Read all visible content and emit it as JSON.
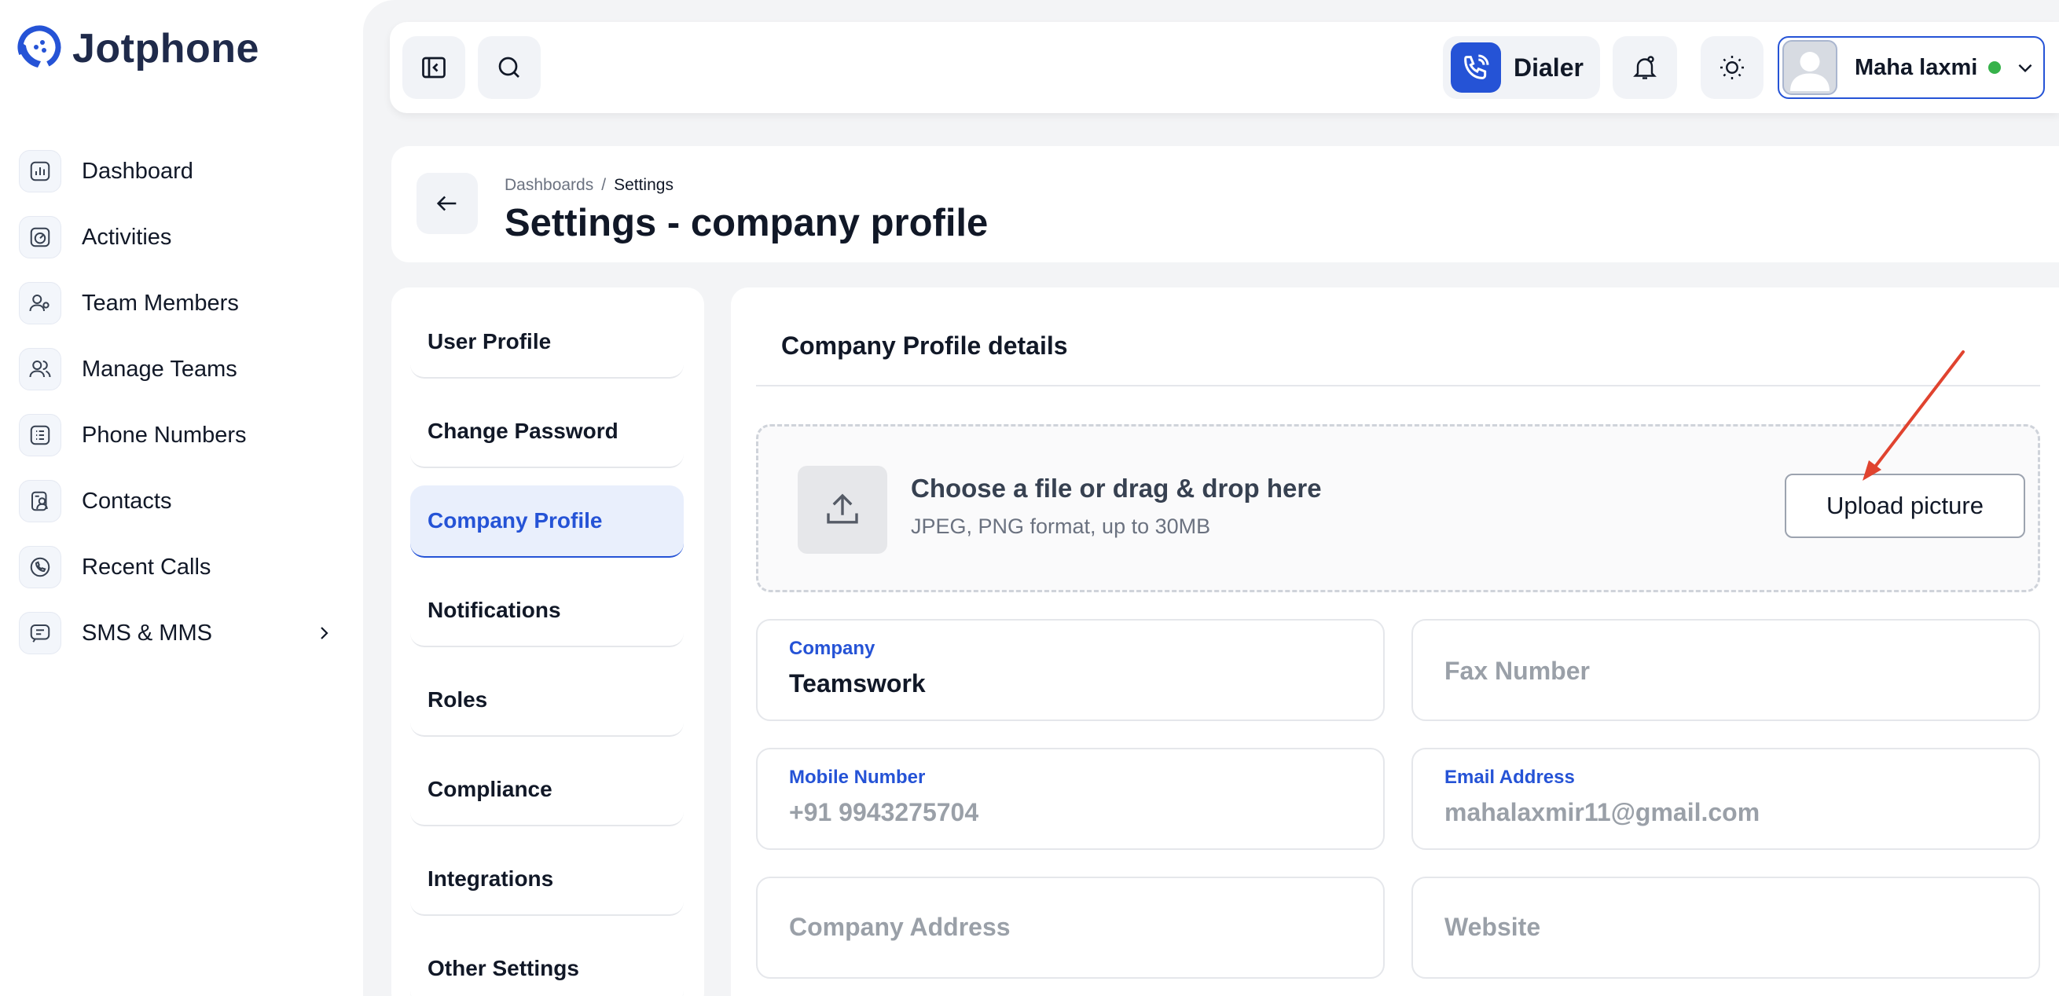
{
  "brand": {
    "name": "Jotphone"
  },
  "sidebar": {
    "items": [
      {
        "label": "Dashboard",
        "icon": "dashboard-icon"
      },
      {
        "label": "Activities",
        "icon": "activities-icon"
      },
      {
        "label": "Team Members",
        "icon": "team-members-icon"
      },
      {
        "label": "Manage Teams",
        "icon": "manage-teams-icon"
      },
      {
        "label": "Phone Numbers",
        "icon": "phone-numbers-icon"
      },
      {
        "label": "Contacts",
        "icon": "contacts-icon"
      },
      {
        "label": "Recent Calls",
        "icon": "recent-calls-icon"
      },
      {
        "label": "SMS & MMS",
        "icon": "sms-icon"
      }
    ]
  },
  "topbar": {
    "dialer_label": "Dialer",
    "user_name": "Maha laxmi",
    "status_color": "#36b24a"
  },
  "header": {
    "breadcrumb": {
      "root": "Dashboards",
      "separator": "/",
      "current": "Settings"
    },
    "title": "Settings - company profile"
  },
  "settings_menu": {
    "items": [
      {
        "label": "User Profile"
      },
      {
        "label": "Change Password"
      },
      {
        "label": "Company Profile",
        "active": true
      },
      {
        "label": "Notifications"
      },
      {
        "label": "Roles"
      },
      {
        "label": "Compliance"
      },
      {
        "label": "Integrations"
      },
      {
        "label": "Other Settings"
      }
    ]
  },
  "content": {
    "section_title": "Company Profile details",
    "upload": {
      "title": "Choose a file or drag & drop here",
      "subtitle": "JPEG, PNG format, up to 30MB",
      "button_label": "Upload picture"
    },
    "fields": {
      "company": {
        "label": "Company",
        "value": "Teamswork"
      },
      "fax": {
        "placeholder": "Fax Number"
      },
      "mobile": {
        "label": "Mobile Number",
        "value": "+91 9943275704"
      },
      "email": {
        "label": "Email Address",
        "value": "mahalaxmir11@gmail.com"
      },
      "address": {
        "placeholder": "Company Address"
      },
      "website": {
        "placeholder": "Website"
      }
    }
  },
  "colors": {
    "accent": "#2553d6",
    "annotation_arrow": "#e0432f"
  }
}
